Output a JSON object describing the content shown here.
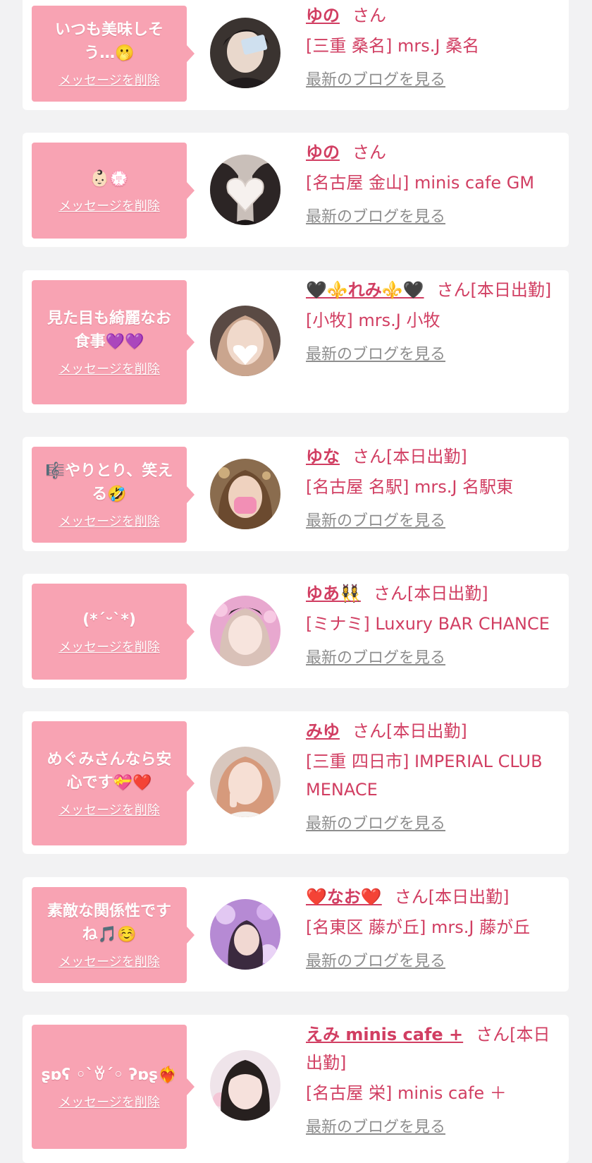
{
  "delete_label": "メッセージを削除",
  "blog_label": "最新のブログを見る",
  "colors": {
    "accent": "#d13e62",
    "bubble": "#f8a3b3",
    "link_gray": "#8e8e8e",
    "bg": "#f2f2f3"
  },
  "items": [
    {
      "message": "いつも美味しそう…🫢",
      "name": "ゆの",
      "suffix": "さん",
      "shop": "[三重 桑名] mrs.J 桑名",
      "avatar_icon": "photo-girl-with-card"
    },
    {
      "message": "👶🏻💮",
      "name": "ゆの",
      "suffix": "さん",
      "shop": "[名古屋 金山] minis cafe GM",
      "avatar_icon": "photo-heart-mask"
    },
    {
      "message": "見た目も綺麗なお食事💜💜",
      "name": "🖤⚜️れみ⚜️🖤",
      "suffix": "さん[本日出勤]",
      "shop": "[小牧] mrs.J 小牧",
      "avatar_icon": "photo-heart-face"
    },
    {
      "message": "🎼やりとり、笑える🤣",
      "name": "ゆな",
      "suffix": "さん[本日出勤]",
      "shop": "[名古屋 名駅] mrs.J 名駅東",
      "avatar_icon": "photo-thank-you-mask"
    },
    {
      "message": "(*ˊᵕˋ*)",
      "name": "ゆあ👯‍♀️",
      "suffix": "さん[本日出勤]",
      "shop": "[ミナミ] Luxury BAR CHANCE",
      "avatar_icon": "photo-wink-girl"
    },
    {
      "message": "めぐみさんなら安心です💝❤️",
      "name": "みゆ",
      "suffix": "さん[本日出勤]",
      "shop": "[三重 四日市] IMPERIAL CLUB MENACE",
      "avatar_icon": "photo-peace-girl"
    },
    {
      "message": "素敵な関係性ですね🎵☺️",
      "name": "❤️なお❤️",
      "suffix": "さん[本日出勤]",
      "shop": "[名東区 藤が丘] mrs.J 藤が丘",
      "avatar_icon": "photo-purple-flowers"
    },
    {
      "message": "ʂɒʕ ◦`ꈊ´◦ ʔɒʂ❤️‍🔥",
      "name": "えみ minis cafe +",
      "suffix": "さん[本日出勤]",
      "shop": "[名古屋 栄] minis cafe ＋",
      "avatar_icon": "photo-bangs-girl"
    }
  ]
}
